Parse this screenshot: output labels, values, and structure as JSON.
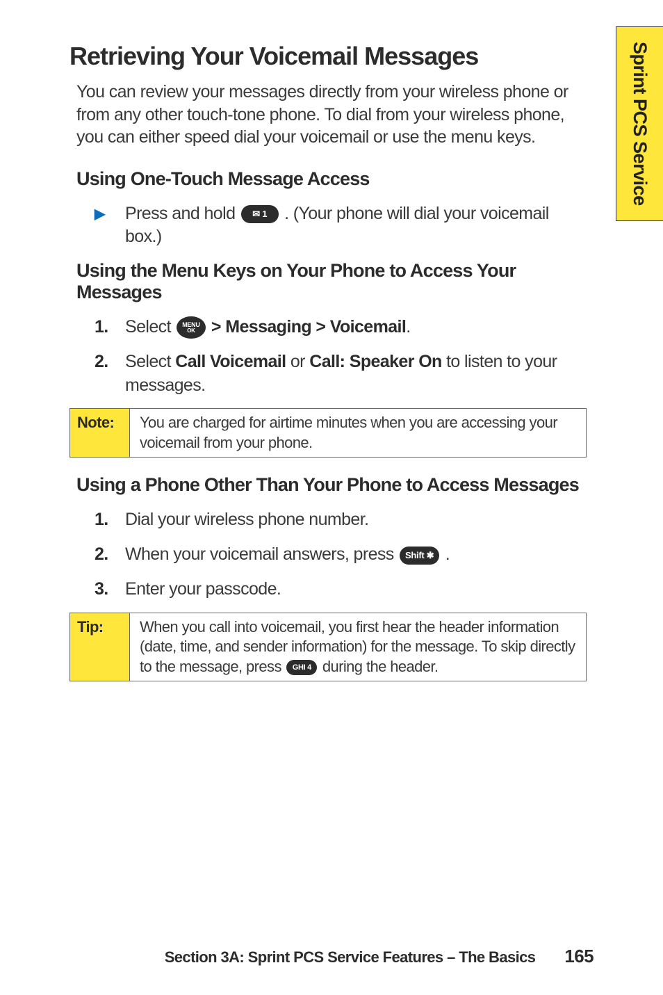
{
  "sideTab": "Sprint PCS Service",
  "h1": "Retrieving Your Voicemail Messages",
  "intro": "You can review your messages directly from your wireless phone or from any other touch-tone phone. To dial from your wireless phone, you can either speed dial your voicemail or use the menu keys.",
  "sections": {
    "oneTouch": {
      "heading": "Using One-Touch Message Access",
      "step_a": "Press and hold ",
      "step_b": " . (Your phone will dial your voicemail box.)",
      "icon1": "✉ 1"
    },
    "menuKeys": {
      "heading": "Using the Menu Keys on Your Phone to Access Your Messages",
      "step1_a": "Select ",
      "step1_b": " > Messaging > Voicemail",
      "step1_c": ".",
      "menuTop": "MENU",
      "menuBot": "OK",
      "step2_a": "Select ",
      "step2_b": "Call Voicemail",
      "step2_c": " or ",
      "step2_d": "Call: Speaker On",
      "step2_e": " to listen to your messages."
    },
    "note": {
      "label": "Note:",
      "body": "You are charged for airtime minutes when you are accessing your voicemail from your phone."
    },
    "otherPhone": {
      "heading": "Using a Phone Other Than Your Phone to Access Messages",
      "step1": "Dial your wireless phone number.",
      "step2_a": "When your voicemail answers, press ",
      "step2_b": " .",
      "iconShift": "Shift ✱",
      "step3": "Enter your passcode."
    },
    "tip": {
      "label": "Tip:",
      "body_a": "When you call into voicemail, you first hear the header information (date, time, and sender information) for the message. To skip directly to the message, press ",
      "body_b": " during the header.",
      "icon4": "GHI 4"
    }
  },
  "footer": {
    "title": "Section 3A: Sprint PCS Service Features – The Basics",
    "page": "165"
  },
  "markers": {
    "tri": "▶",
    "n1": "1.",
    "n2": "2.",
    "n3": "3."
  }
}
